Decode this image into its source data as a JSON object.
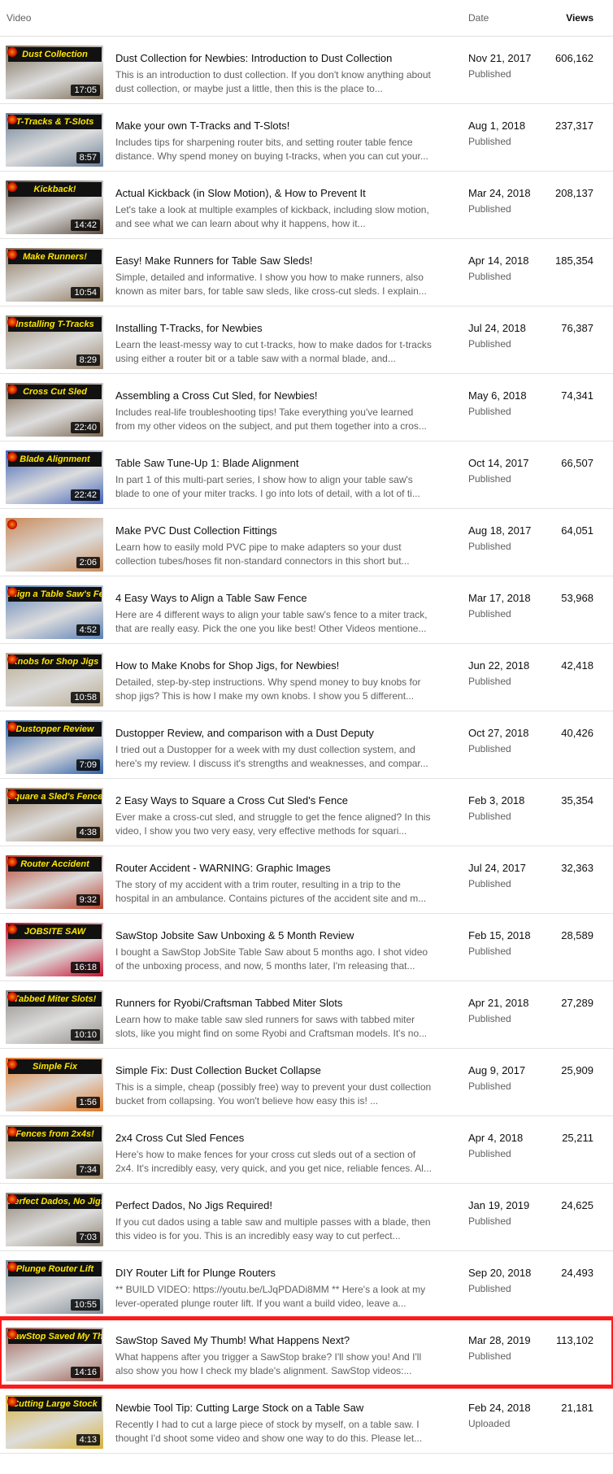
{
  "header": {
    "video": "Video",
    "date": "Date",
    "views": "Views"
  },
  "videos": [
    {
      "title": "Dust Collection for Newbies: Introduction to Dust Collection",
      "desc": "This is an introduction to dust collection. If you don't know anything about dust collection, or maybe just a little, then this is the place to...",
      "date": "Nov 21, 2017",
      "status": "Published",
      "views": "606,162",
      "duration": "17:05",
      "thumb_text": "Dust Collection",
      "thumb_color": "#7a6a55",
      "highlighted": false
    },
    {
      "title": "Make your own T-Tracks and T-Slots!",
      "desc": "Includes tips for sharpening router bits, and setting router table fence distance. Why spend money on buying t-tracks, when you can cut your...",
      "date": "Aug 1, 2018",
      "status": "Published",
      "views": "237,317",
      "duration": "8:57",
      "thumb_text": "T-Tracks & T-Slots",
      "thumb_color": "#6a7f96",
      "highlighted": false
    },
    {
      "title": "Actual Kickback (in Slow Motion), & How to Prevent It",
      "desc": "Let's take a look at multiple examples of kickback, including slow motion, and see what we can learn about why it happens, how it...",
      "date": "Mar 24, 2018",
      "status": "Published",
      "views": "208,137",
      "duration": "14:42",
      "thumb_text": "Kickback!",
      "thumb_color": "#5b4a3c",
      "highlighted": false
    },
    {
      "title": "Easy! Make Runners for Table Saw Sleds!",
      "desc": "Simple, detailed and informative. I show you how to make runners, also known as miter bars, for table saw sleds, like cross-cut sleds. I explain...",
      "date": "Apr 14, 2018",
      "status": "Published",
      "views": "185,354",
      "duration": "10:54",
      "thumb_text": "Make Runners!",
      "thumb_color": "#8a7358",
      "highlighted": false
    },
    {
      "title": "Installing T-Tracks, for Newbies",
      "desc": "Learn the least-messy way to cut t-tracks, how to make dados for t-tracks using either a router bit or a table saw with a normal blade, and...",
      "date": "Jul 24, 2018",
      "status": "Published",
      "views": "76,387",
      "duration": "8:29",
      "thumb_text": "Installing T-Tracks",
      "thumb_color": "#9c8a74",
      "highlighted": false
    },
    {
      "title": "Assembling a Cross Cut Sled, for Newbies!",
      "desc": "Includes real-life troubleshooting tips! Take everything you've learned from my other videos on the subject, and put them together into a cros...",
      "date": "May 6, 2018",
      "status": "Published",
      "views": "74,341",
      "duration": "22:40",
      "thumb_text": "Cross Cut Sled",
      "thumb_color": "#7c6650",
      "highlighted": false
    },
    {
      "title": "Table Saw Tune-Up 1: Blade Alignment",
      "desc": "In part 1 of this multi-part series, I show how to align your table saw's blade to one of your miter tracks. I go into lots of detail, with a lot of ti...",
      "date": "Oct 14, 2017",
      "status": "Published",
      "views": "66,507",
      "duration": "22:42",
      "thumb_text": "Blade Alignment",
      "thumb_color": "#3f63b8",
      "highlighted": false
    },
    {
      "title": "Make PVC Dust Collection Fittings",
      "desc": "Learn how to easily mold PVC pipe to make adapters so your dust collection tubes/hoses fit non-standard connectors in this short but...",
      "date": "Aug 18, 2017",
      "status": "Published",
      "views": "64,051",
      "duration": "2:06",
      "thumb_text": "",
      "thumb_color": "#c98a5a",
      "highlighted": false
    },
    {
      "title": "4 Easy Ways to Align a Table Saw Fence",
      "desc": "Here are 4 different ways to align your table saw's fence to a miter track, that are really easy. Pick the one you like best! Other Videos mentione...",
      "date": "Mar 17, 2018",
      "status": "Published",
      "views": "53,968",
      "duration": "4:52",
      "thumb_text": "Align a Table Saw's Fence",
      "thumb_color": "#5a7fb5",
      "highlighted": false
    },
    {
      "title": "How to Make Knobs for Shop Jigs, for Newbies!",
      "desc": "Detailed, step-by-step instructions. Why spend money to buy knobs for shop jigs? This is how I make my own knobs. I show you 5 different...",
      "date": "Jun 22, 2018",
      "status": "Published",
      "views": "42,418",
      "duration": "10:58",
      "thumb_text": "Knobs for Shop Jigs",
      "thumb_color": "#b8a98c",
      "highlighted": false
    },
    {
      "title": "Dustopper Review, and comparison with a Dust Deputy",
      "desc": "I tried out a Dustopper for a week with my dust collection system, and here's my review. I discuss it's strengths and weaknesses, and compar...",
      "date": "Oct 27, 2018",
      "status": "Published",
      "views": "40,426",
      "duration": "7:09",
      "thumb_text": "Dustopper Review",
      "thumb_color": "#2d5fa8",
      "highlighted": false
    },
    {
      "title": "2 Easy Ways to Square a Cross Cut Sled's Fence",
      "desc": "Ever make a cross-cut sled, and struggle to get the fence aligned? In this video, I show you two very easy, very effective methods for squari...",
      "date": "Feb 3, 2018",
      "status": "Published",
      "views": "35,354",
      "duration": "4:38",
      "thumb_text": "Square a Sled's Fence",
      "thumb_color": "#9a7a5a",
      "highlighted": false
    },
    {
      "title": "Router Accident - WARNING: Graphic Images",
      "desc": "The story of my accident with a trim router, resulting in a trip to the hospital in an ambulance. Contains pictures of the accident site and m...",
      "date": "Jul 24, 2017",
      "status": "Published",
      "views": "32,363",
      "duration": "9:32",
      "thumb_text": "Router Accident",
      "thumb_color": "#b8402a",
      "highlighted": false
    },
    {
      "title": "SawStop Jobsite Saw Unboxing & 5 Month Review",
      "desc": "I bought a SawStop JobSite Table Saw about 5 months ago. I shot video of the unboxing process, and now, 5 months later, I'm releasing that...",
      "date": "Feb 15, 2018",
      "status": "Published",
      "views": "28,589",
      "duration": "16:18",
      "thumb_text": "JOBSITE SAW",
      "thumb_color": "#c8102e",
      "highlighted": false
    },
    {
      "title": "Runners for Ryobi/Craftsman Tabbed Miter Slots",
      "desc": "Learn how to make table saw sled runners for saws with tabbed miter slots, like you might find on some Ryobi and Craftsman models. It's no...",
      "date": "Apr 21, 2018",
      "status": "Published",
      "views": "27,289",
      "duration": "10:10",
      "thumb_text": "Tabbed Miter Slots!",
      "thumb_color": "#8f8a84",
      "highlighted": false
    },
    {
      "title": "Simple Fix: Dust Collection Bucket Collapse",
      "desc": "This is a simple, cheap (possibly free) way to prevent your dust collection bucket from collapsing. You won't believe how easy this is! ...",
      "date": "Aug 9, 2017",
      "status": "Published",
      "views": "25,909",
      "duration": "1:56",
      "thumb_text": "Simple Fix",
      "thumb_color": "#e07a2c",
      "highlighted": false
    },
    {
      "title": "2x4 Cross Cut Sled Fences",
      "desc": "Here's how to make fences for your cross cut sleds out of a section of 2x4. It's incredibly easy, very quick, and you get nice, reliable fences. Al...",
      "date": "Apr 4, 2018",
      "status": "Published",
      "views": "25,211",
      "duration": "7:34",
      "thumb_text": "Fences from 2x4s!",
      "thumb_color": "#a08868",
      "highlighted": false
    },
    {
      "title": "Perfect Dados, No Jigs Required!",
      "desc": "If you cut dados using a table saw and multiple passes with a blade, then this video is for you. This is an incredibly easy way to cut perfect...",
      "date": "Jan 19, 2019",
      "status": "Published",
      "views": "24,625",
      "duration": "7:03",
      "thumb_text": "Perfect Dados, No Jigs",
      "thumb_color": "#8c8070",
      "highlighted": false
    },
    {
      "title": "DIY Router Lift for Plunge Routers",
      "desc": "** BUILD VIDEO: https://youtu.be/LJqPDADi8MM ** Here's a look at my lever-operated plunge router lift. If you want a build video, leave a...",
      "date": "Sep 20, 2018",
      "status": "Published",
      "views": "24,493",
      "duration": "10:55",
      "thumb_text": "Plunge Router Lift",
      "thumb_color": "#7d8a96",
      "highlighted": false
    },
    {
      "title": "SawStop Saved My Thumb! What Happens Next?",
      "desc": "What happens after you trigger a SawStop brake? I'll show you! And I'll also show you how I check my blade's alignment. SawStop videos:...",
      "date": "Mar 28, 2019",
      "status": "Published",
      "views": "113,102",
      "duration": "14:16",
      "thumb_text": "SawStop Saved My Thumb",
      "thumb_color": "#9b5a4e",
      "highlighted": true
    },
    {
      "title": "Newbie Tool Tip: Cutting Large Stock on a Table Saw",
      "desc": "Recently I had to cut a large piece of stock by myself, on a table saw. I thought I'd shoot some video and show one way to do this. Please let...",
      "date": "Feb 24, 2018",
      "status": "Uploaded",
      "views": "21,181",
      "duration": "4:13",
      "thumb_text": "Cutting Large Stock",
      "thumb_color": "#d8b23a",
      "highlighted": false
    }
  ]
}
